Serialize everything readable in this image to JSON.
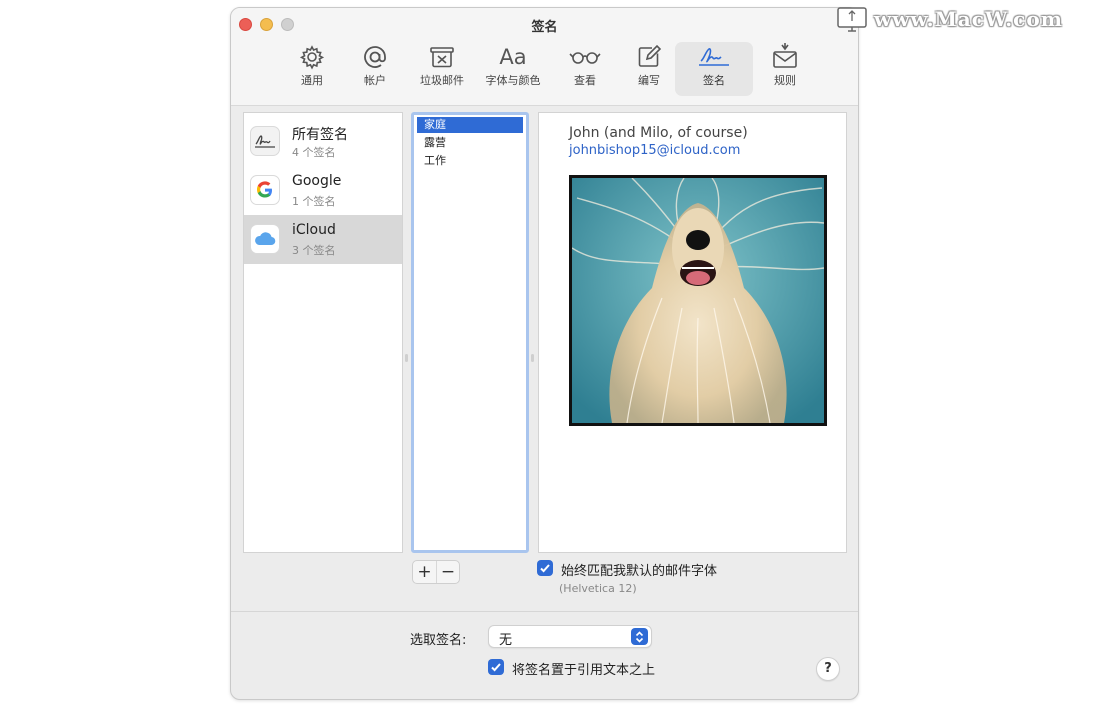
{
  "window": {
    "title": "签名"
  },
  "toolbar": {
    "items": [
      {
        "label": "通用",
        "icon": "gear-icon"
      },
      {
        "label": "帐户",
        "icon": "at-icon"
      },
      {
        "label": "垃圾邮件",
        "icon": "junk-mail-icon"
      },
      {
        "label": "字体与颜色",
        "icon": "fonts-icon",
        "glyph": "Aa"
      },
      {
        "label": "查看",
        "icon": "glasses-icon"
      },
      {
        "label": "编写",
        "icon": "compose-icon"
      },
      {
        "label": "签名",
        "icon": "signature-icon",
        "selected": true
      },
      {
        "label": "规则",
        "icon": "rules-icon"
      }
    ]
  },
  "accounts": [
    {
      "name": "所有签名",
      "count": "4 个签名",
      "icon": "signature-icon"
    },
    {
      "name": "Google",
      "count": "1 个签名",
      "icon": "google-icon"
    },
    {
      "name": "iCloud",
      "count": "3 个签名",
      "icon": "icloud-icon",
      "selected": true
    }
  ],
  "signatures": [
    {
      "name": "家庭",
      "selected": true
    },
    {
      "name": "露营"
    },
    {
      "name": "工作"
    }
  ],
  "preview": {
    "name": "John (and Milo, of course)",
    "email": "johnbishop15@icloud.com",
    "photo_icon": "dog-photo"
  },
  "buttons": {
    "add": "+",
    "remove": "−"
  },
  "options": {
    "match_font_label": "始终匹配我默认的邮件字体",
    "match_font_checked": true,
    "font_note": "(Helvetica 12)",
    "choose_label": "选取签名:",
    "choose_value": "无",
    "place_above_label": "将签名置于引用文本之上",
    "place_above_checked": true,
    "help": "?"
  },
  "colors": {
    "accent": "#2f6bd5",
    "link": "#2e63c7"
  },
  "watermark": {
    "text": "www.MacW.com"
  }
}
